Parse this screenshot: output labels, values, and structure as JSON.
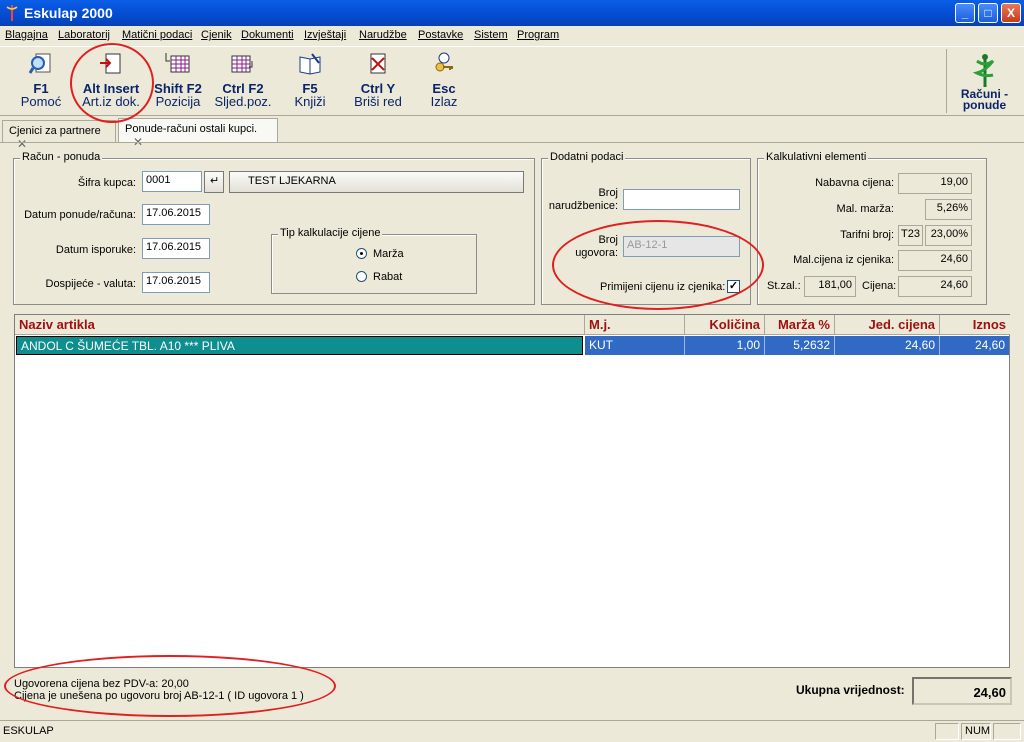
{
  "window": {
    "title": "Eskulap 2000",
    "minimize": "_",
    "maximize": "□",
    "close": "X"
  },
  "menu": [
    "Blagajna",
    "Laboratorij",
    "Matični podaci",
    "Cjenik",
    "Dokumenti",
    "Izvještaji",
    "Narudžbe",
    "Postavke",
    "Sistem",
    "Program"
  ],
  "toolbar": {
    "buttons": [
      {
        "key": "F1",
        "label": "Pomoć",
        "icon": "magnifier-document-icon"
      },
      {
        "key": "Alt Insert",
        "label": "Art.iz dok.",
        "icon": "insert-document-icon"
      },
      {
        "key": "Shift F2",
        "label": "Pozicija",
        "icon": "grid-position-icon"
      },
      {
        "key": "Ctrl F2",
        "label": "Sljed.poz.",
        "icon": "grid-next-icon"
      },
      {
        "key": "F5",
        "label": "Knjiži",
        "icon": "book-post-icon"
      },
      {
        "key": "Ctrl Y",
        "label": "Briši red",
        "icon": "delete-row-icon"
      },
      {
        "key": "Esc",
        "label": "Izlaz",
        "icon": "exit-key-icon"
      }
    ],
    "right_label_line1": "Računi -",
    "right_label_line2": "ponude"
  },
  "tabs": [
    {
      "label": "Cjenici za partnere",
      "active": false
    },
    {
      "label": "Ponude-računi ostali kupci.",
      "active": true
    }
  ],
  "racun": {
    "legend": "Račun - ponuda",
    "sifra_label": "Šifra kupca:",
    "sifra_value": "0001",
    "kupac_name": "TEST LJEKARNA",
    "datum_ponude_label": "Datum ponude/računa:",
    "datum_ponude": "17.06.2015",
    "datum_isporuke_label": "Datum isporuke:",
    "datum_isporuke": "17.06.2015",
    "dospijece_label": "Dospijeće - valuta:",
    "dospijece": "17.06.2015",
    "tip_legend": "Tip kalkulacije cijene",
    "opt_marza": "Marža",
    "opt_rabat": "Rabat"
  },
  "dodatni": {
    "legend": "Dodatni podaci",
    "broj_nar_label1": "Broj",
    "broj_nar_label2": "narudžbenice:",
    "broj_nar_value": "",
    "broj_ug_label1": "Broj",
    "broj_ug_label2": "ugovora:",
    "broj_ug_value": "AB-12-1",
    "primijeni_label": "Primijeni cijenu iz cjenika:",
    "primijeni_checked": "✓"
  },
  "kalk": {
    "legend": "Kalkulativni elementi",
    "nabavna_label": "Nabavna cijena:",
    "nabavna": "19,00",
    "marza_label": "Mal. marža:",
    "marza": "5,26%",
    "tarifni_label": "Tarifni broj:",
    "tarifni_code": "T23",
    "tarifni_pct": "23,00%",
    "malcijena_label": "Mal.cijena iz cjenika:",
    "malcijena": "24,60",
    "stzal_label": "St.zal.:",
    "stzal": "181,00",
    "cijena_label": "Cijena:",
    "cijena": "24,60"
  },
  "grid": {
    "headers": [
      "Naziv artikla",
      "M.j.",
      "Količina",
      "Marža %",
      "Jed. cijena",
      "Iznos"
    ],
    "rows": [
      [
        "ANDOL C ŠUMEĆE TBL. A10 *** PLIVA",
        "KUT",
        "1,00",
        "5,2632",
        "24,60",
        "24,60"
      ]
    ]
  },
  "footer": {
    "note1": "Ugovorena cijena bez PDV-a: 20,00",
    "note2": "Cijena je unešena po ugovoru broj AB-12-1  ( ID ugovora 1 )",
    "total_label": "Ukupna vrijednost:",
    "total_value": "24,60"
  },
  "status": {
    "left": "ESKULAP",
    "num": "NUM"
  },
  "colors": {
    "titlebar": "#0551d8",
    "header_text": "#a01010",
    "selection": "#316ac5",
    "annotation": "#e02020"
  }
}
